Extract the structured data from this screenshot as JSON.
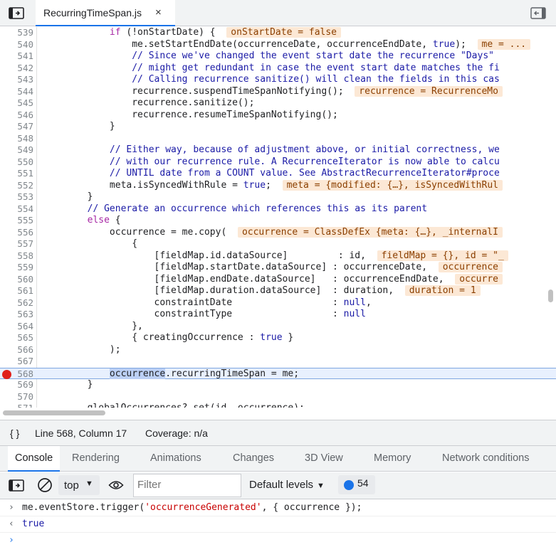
{
  "tab": {
    "file_name": "RecurringTimeSpan.js",
    "close_glyph": "×"
  },
  "editor": {
    "lines": [
      {
        "n": "539",
        "html": "            <span class=\"kw\">if</span> (!onStartDate) {  <span class=\"inl\">onStartDate = false</span>"
      },
      {
        "n": "540",
        "html": "                me.setStartEndDate(occurrenceDate, occurrenceEndDate, <span class=\"lit\">true</span>);  <span class=\"inl\">me = ...</span>"
      },
      {
        "n": "541",
        "html": "                <span class=\"cm\">// Since we've changed the event start date the recurrence \"Days\"</span>"
      },
      {
        "n": "542",
        "html": "                <span class=\"cm\">// might get redundant in case the event start date matches the fi</span>"
      },
      {
        "n": "543",
        "html": "                <span class=\"cm\">// Calling recurrence sanitize() will clean the fields in this cas</span>"
      },
      {
        "n": "544",
        "html": "                recurrence.suspendTimeSpanNotifying();  <span class=\"inl\">recurrence = RecurrenceMo</span>"
      },
      {
        "n": "545",
        "html": "                recurrence.sanitize();"
      },
      {
        "n": "546",
        "html": "                recurrence.resumeTimeSpanNotifying();"
      },
      {
        "n": "547",
        "html": "            }"
      },
      {
        "n": "548",
        "html": ""
      },
      {
        "n": "549",
        "html": "            <span class=\"cm\">// Either way, because of adjustment above, or initial correctness, we</span>"
      },
      {
        "n": "550",
        "html": "            <span class=\"cm\">// with our recurrence rule. A RecurrenceIterator is now able to calcu</span>"
      },
      {
        "n": "551",
        "html": "            <span class=\"cm\">// UNTIL date from a COUNT value. See AbstractRecurrenceIterator#proce</span>"
      },
      {
        "n": "552",
        "html": "            meta.isSyncedWithRule = <span class=\"lit\">true</span>;  <span class=\"inl\">meta = {modified: {…}, isSyncedWithRul</span>"
      },
      {
        "n": "553",
        "html": "        }"
      },
      {
        "n": "554",
        "html": "        <span class=\"cm\">// Generate an occurrence which references this as its parent</span>"
      },
      {
        "n": "555",
        "html": "        <span class=\"kw\">else</span> {"
      },
      {
        "n": "556",
        "html": "            occurrence = me.copy(  <span class=\"inl\">occurrence = ClassDefEx {meta: {…}, _internalI</span>"
      },
      {
        "n": "557",
        "html": "                {"
      },
      {
        "n": "558",
        "html": "                    [fieldMap.id.dataSource]         : id,  <span class=\"inl\">fieldMap = {}, id = \"_</span>"
      },
      {
        "n": "559",
        "html": "                    [fieldMap.startDate.dataSource] : occurrenceDate,  <span class=\"inl\">occurrence</span>"
      },
      {
        "n": "560",
        "html": "                    [fieldMap.endDate.dataSource]   : occurrenceEndDate,  <span class=\"inl\">occurre</span>"
      },
      {
        "n": "561",
        "html": "                    [fieldMap.duration.dataSource]  : duration,  <span class=\"inl\">duration = 1</span>"
      },
      {
        "n": "562",
        "html": "                    constraintDate                  : <span class=\"lit\">null</span>,"
      },
      {
        "n": "563",
        "html": "                    constraintType                  : <span class=\"lit\">null</span>"
      },
      {
        "n": "564",
        "html": "                },"
      },
      {
        "n": "565",
        "html": "                { creatingOccurrence : <span class=\"lit\">true</span> }"
      },
      {
        "n": "566",
        "html": "            );"
      },
      {
        "n": "567",
        "html": ""
      },
      {
        "n": "568",
        "html": "            <span class=\"selword\">occurrence</span>.recurringTimeSpan = me;",
        "exec": true,
        "breakpoint": true
      },
      {
        "n": "569",
        "html": "        }"
      },
      {
        "n": "570",
        "html": ""
      },
      {
        "n": "571",
        "html": "        globalOccurrences?.set(id, occurrence);"
      }
    ]
  },
  "status": {
    "braces": "{ }",
    "position": "Line 568, Column 17",
    "coverage": "Coverage: n/a"
  },
  "drawer": {
    "tabs": [
      "Console",
      "Rendering",
      "Animations",
      "Changes",
      "3D View",
      "Memory",
      "Network conditions"
    ]
  },
  "console_toolbar": {
    "context": "top",
    "filter_placeholder": "Filter",
    "levels": "Default levels",
    "message_count": "54"
  },
  "console": {
    "input": "me.eventStore.trigger(",
    "input_str": "'occurrenceGenerated'",
    "input_tail": ", { occurrence });",
    "result": "true",
    "prompt": "›"
  }
}
